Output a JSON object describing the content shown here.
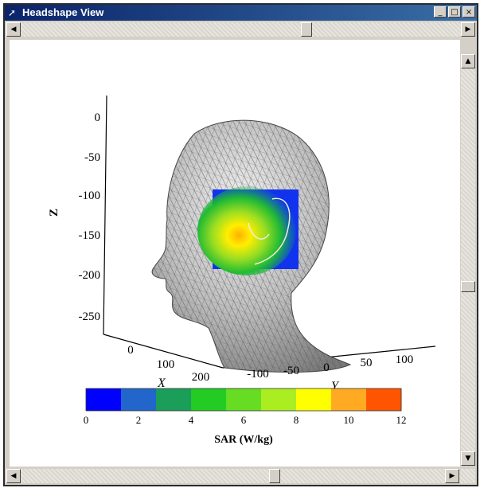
{
  "window": {
    "title": "Headshape View",
    "minimize_glyph": "_",
    "maximize_glyph": "□",
    "close_glyph": "×"
  },
  "scrollbars": {
    "left_arrow": "◀",
    "right_arrow": "▶",
    "up_arrow": "▲",
    "down_arrow": "▼"
  },
  "plot": {
    "z_label": "Z",
    "x_label": "X",
    "y_label": "Y",
    "z_ticks": [
      "0",
      "-50",
      "-100",
      "-150",
      "-200",
      "-250"
    ],
    "x_ticks": [
      "0",
      "100",
      "200"
    ],
    "y_ticks": [
      "-100",
      "-50",
      "0",
      "50",
      "100"
    ],
    "colorbar": {
      "label": "SAR (W/kg)",
      "ticks": [
        "0",
        "2",
        "4",
        "6",
        "8",
        "10",
        "12"
      ],
      "colors": [
        "#0000ff",
        "#2266cc",
        "#1a9e5a",
        "#22cc22",
        "#66dd22",
        "#aaee22",
        "#ffff00",
        "#ffaa22",
        "#ff5500"
      ]
    }
  }
}
